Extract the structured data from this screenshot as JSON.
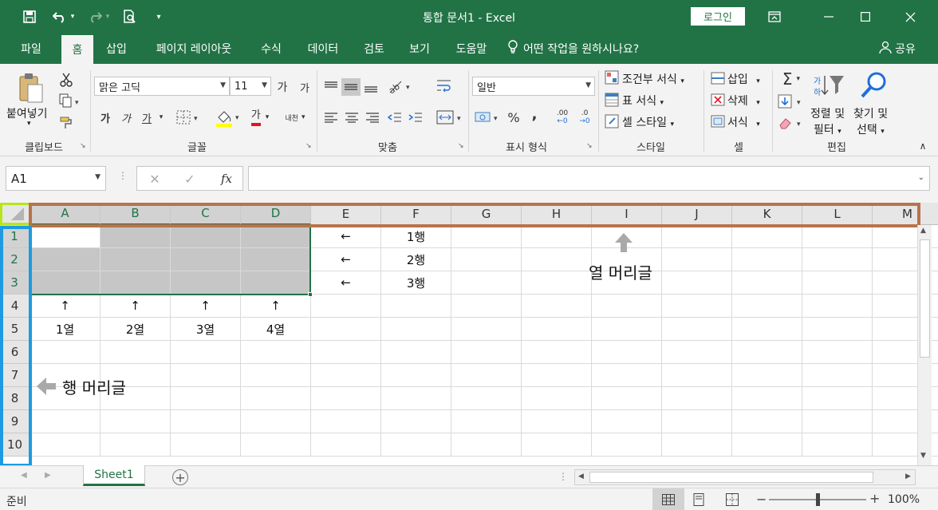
{
  "app": {
    "title": "통합 문서1  -  Excel",
    "login_label": "로그인",
    "share_label": "공유",
    "tell_me": "어떤 작업을 원하시나요?"
  },
  "colors": {
    "brand": "#217346",
    "column_header_outline": "#b8734b",
    "row_header_outline": "#1e9be0",
    "corner_highlight": "#b7e51c"
  },
  "tabs": [
    {
      "label": "파일"
    },
    {
      "label": "홈",
      "active": true
    },
    {
      "label": "삽입"
    },
    {
      "label": "페이지 레이아웃"
    },
    {
      "label": "수식"
    },
    {
      "label": "데이터"
    },
    {
      "label": "검토"
    },
    {
      "label": "보기"
    },
    {
      "label": "도움말"
    }
  ],
  "ribbon": {
    "clipboard": {
      "paste_label": "붙여넣기",
      "group_label": "클립보드"
    },
    "font": {
      "name": "맑은 고딕",
      "size": "11",
      "grow_label": "가",
      "shrink_label": "가",
      "bold": "가",
      "italic": "가",
      "underline": "가",
      "font_color_label": "가",
      "phonetic_label": "내천",
      "group_label": "글꼴"
    },
    "alignment": {
      "group_label": "맞춤"
    },
    "number": {
      "format": "일반",
      "percent": "%",
      "comma": ",",
      "inc_decimal": ".00",
      "dec_decimal": ".0",
      "group_label": "표시 형식"
    },
    "styles": {
      "conditional": "조건부 서식",
      "table": "표 서식",
      "cell_styles": "셀 스타일",
      "group_label": "스타일"
    },
    "cells": {
      "insert": "삽입",
      "delete": "삭제",
      "format": "서식",
      "group_label": "셀"
    },
    "editing": {
      "sort_filter_1": "정렬 및",
      "sort_filter_2": "필터",
      "find_select_1": "찾기 및",
      "find_select_2": "선택",
      "group_label": "편집"
    }
  },
  "formula_bar": {
    "name_box": "A1",
    "fx": "fx",
    "value": ""
  },
  "grid": {
    "columns": [
      "A",
      "B",
      "C",
      "D",
      "E",
      "F",
      "G",
      "H",
      "I",
      "J",
      "K",
      "L",
      "M"
    ],
    "rows": [
      "1",
      "2",
      "3",
      "4",
      "5",
      "6",
      "7",
      "8",
      "9",
      "10"
    ],
    "cells": {
      "E1": "←",
      "F1": "1행",
      "E2": "←",
      "F2": "2행",
      "E3": "←",
      "F3": "3행",
      "A4": "↑",
      "B4": "↑",
      "C4": "↑",
      "D4": "↑",
      "A5": "1열",
      "B5": "2열",
      "C5": "3열",
      "D5": "4열"
    },
    "selection": "A1:D3"
  },
  "annotations": {
    "column_header": "열 머리글",
    "row_header": "행 머리글"
  },
  "sheets": [
    {
      "name": "Sheet1",
      "active": true
    }
  ],
  "status": {
    "ready": "준비",
    "zoom": "100%",
    "zoom_level": 1.0
  }
}
